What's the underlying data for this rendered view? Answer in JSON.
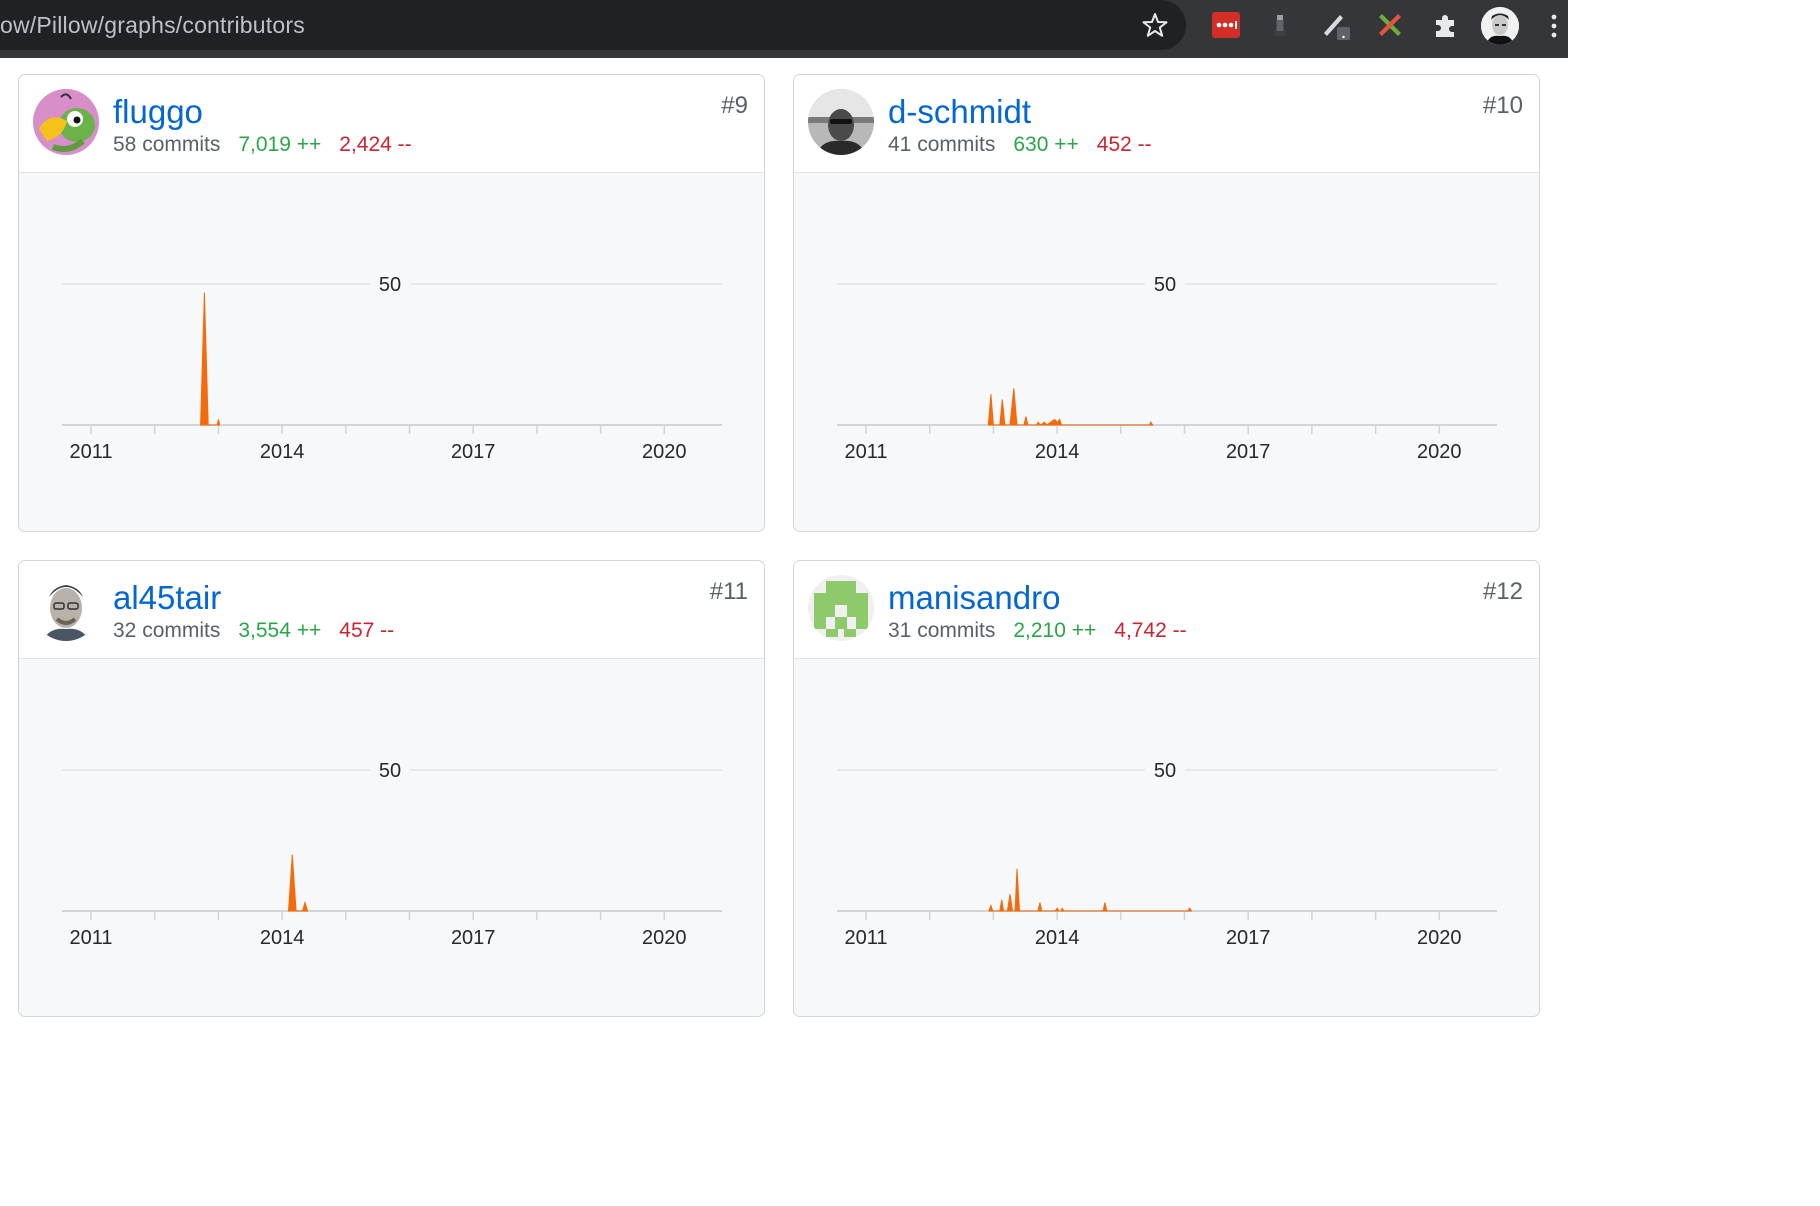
{
  "browser": {
    "url": "ow/Pillow/graphs/contributors"
  },
  "cards": [
    {
      "name": "fluggo",
      "rank": "#9",
      "commits": "58 commits",
      "additions": "7,019 ++",
      "deletions": "2,424 --",
      "chart_data": {
        "type": "area",
        "x_ticks": [
          "2011",
          "2014",
          "2017",
          "2020"
        ],
        "y_ticks": [
          "50"
        ],
        "ylim": [
          0,
          100
        ],
        "color": "#f66a0a",
        "points": [
          [
            2012.72,
            0
          ],
          [
            2012.78,
            47
          ],
          [
            2012.84,
            0
          ],
          [
            2012.98,
            0
          ],
          [
            2013.0,
            2
          ],
          [
            2013.02,
            0
          ]
        ]
      }
    },
    {
      "name": "d-schmidt",
      "rank": "#10",
      "commits": "41 commits",
      "additions": "630 ++",
      "deletions": "452 --",
      "chart_data": {
        "type": "area",
        "x_ticks": [
          "2011",
          "2014",
          "2017",
          "2020"
        ],
        "y_ticks": [
          "50"
        ],
        "ylim": [
          0,
          100
        ],
        "color": "#f66a0a",
        "points": [
          [
            2012.92,
            0
          ],
          [
            2012.96,
            11
          ],
          [
            2013.0,
            0
          ],
          [
            2013.1,
            0
          ],
          [
            2013.14,
            9
          ],
          [
            2013.18,
            0
          ],
          [
            2013.26,
            0
          ],
          [
            2013.32,
            13
          ],
          [
            2013.37,
            0
          ],
          [
            2013.48,
            0
          ],
          [
            2013.51,
            3
          ],
          [
            2013.54,
            0
          ],
          [
            2013.68,
            0
          ],
          [
            2013.7,
            1
          ],
          [
            2013.74,
            0
          ],
          [
            2013.8,
            1
          ],
          [
            2013.84,
            0
          ],
          [
            2013.9,
            1
          ],
          [
            2013.96,
            2
          ],
          [
            2014.0,
            1
          ],
          [
            2014.04,
            2
          ],
          [
            2014.07,
            0
          ],
          [
            2015.45,
            0
          ],
          [
            2015.47,
            1
          ],
          [
            2015.5,
            0
          ]
        ]
      }
    },
    {
      "name": "al45tair",
      "rank": "#11",
      "commits": "32 commits",
      "additions": "3,554 ++",
      "deletions": "457 --",
      "chart_data": {
        "type": "area",
        "x_ticks": [
          "2011",
          "2014",
          "2017",
          "2020"
        ],
        "y_ticks": [
          "50"
        ],
        "ylim": [
          0,
          100
        ],
        "color": "#f66a0a",
        "points": [
          [
            2014.1,
            0
          ],
          [
            2014.16,
            20
          ],
          [
            2014.22,
            0
          ],
          [
            2014.32,
            0
          ],
          [
            2014.36,
            3
          ],
          [
            2014.4,
            0
          ]
        ]
      }
    },
    {
      "name": "manisandro",
      "rank": "#12",
      "commits": "31 commits",
      "additions": "2,210 ++",
      "deletions": "4,742 --",
      "chart_data": {
        "type": "area",
        "x_ticks": [
          "2011",
          "2014",
          "2017",
          "2020"
        ],
        "y_ticks": [
          "50"
        ],
        "ylim": [
          0,
          100
        ],
        "color": "#f66a0a",
        "points": [
          [
            2012.93,
            0
          ],
          [
            2012.96,
            2
          ],
          [
            2012.99,
            0
          ],
          [
            2013.1,
            0
          ],
          [
            2013.13,
            4
          ],
          [
            2013.16,
            0
          ],
          [
            2013.22,
            0
          ],
          [
            2013.26,
            6
          ],
          [
            2013.3,
            0
          ],
          [
            2013.34,
            0
          ],
          [
            2013.37,
            15
          ],
          [
            2013.41,
            0
          ],
          [
            2013.7,
            0
          ],
          [
            2013.73,
            3
          ],
          [
            2013.76,
            0
          ],
          [
            2013.97,
            0
          ],
          [
            2014.0,
            1
          ],
          [
            2014.03,
            0
          ],
          [
            2014.06,
            0
          ],
          [
            2014.08,
            1
          ],
          [
            2014.11,
            0
          ],
          [
            2014.72,
            0
          ],
          [
            2014.75,
            3
          ],
          [
            2014.78,
            0
          ],
          [
            2016.05,
            0
          ],
          [
            2016.08,
            1
          ],
          [
            2016.11,
            0
          ]
        ]
      }
    }
  ]
}
